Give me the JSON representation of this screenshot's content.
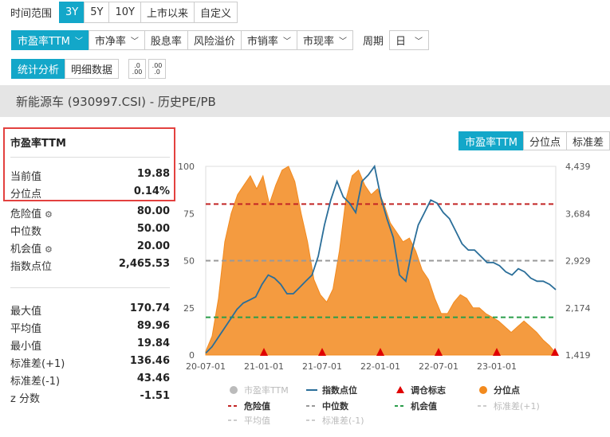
{
  "range": {
    "label": "时间范围",
    "options": [
      "3Y",
      "5Y",
      "10Y",
      "上市以来",
      "自定义"
    ],
    "active": "3Y"
  },
  "metrics": [
    "市盈率TTM",
    "市净率",
    "股息率",
    "风险溢价",
    "市销率",
    "市现率"
  ],
  "period": {
    "label": "周期",
    "value": "日"
  },
  "view_tabs": [
    "统计分析",
    "明细数据"
  ],
  "decimal_icons": [
    ".0 .00",
    ".00 .0"
  ],
  "page_title": "新能源车 (930997.CSI) - 历史PE/PB",
  "stats_title": "市盈率TTM",
  "stats": [
    {
      "label": "当前值",
      "value": "19.88"
    },
    {
      "label": "分位点",
      "value": "0.14%"
    },
    {
      "label": "危险值",
      "value": "80.00",
      "gear": true
    },
    {
      "label": "中位数",
      "value": "50.00"
    },
    {
      "label": "机会值",
      "value": "20.00",
      "gear": true
    },
    {
      "label": "指数点位",
      "value": "2,465.53"
    },
    {
      "label": "最大值",
      "value": "170.74"
    },
    {
      "label": "平均值",
      "value": "89.96"
    },
    {
      "label": "最小值",
      "value": "19.84"
    },
    {
      "label": "标准差(+1)",
      "value": "136.46"
    },
    {
      "label": "标准差(-1)",
      "value": "43.46"
    },
    {
      "label": "z 分数",
      "value": "-1.51"
    }
  ],
  "chart_tabs": [
    "市盈率TTM",
    "分位点",
    "标准差"
  ],
  "colors": {
    "accent": "#13a7c9",
    "area": "#f28a1e",
    "index": "#2a6e99",
    "danger": "#c22525",
    "median": "#999999",
    "opportunity": "#2a9d4a",
    "marker": "#e00000"
  },
  "chart_data": {
    "type": "area",
    "x_ticks": [
      "20-07-01",
      "21-01-01",
      "21-07-01",
      "22-01-01",
      "22-07-01",
      "23-01-01"
    ],
    "y_left_ticks": [
      "0",
      "25",
      "50",
      "75",
      "100"
    ],
    "y_right_ticks": [
      "1,419",
      "2,174",
      "2,929",
      "3,684",
      "4,439"
    ],
    "ylim_left": [
      0,
      100
    ],
    "ylim_right": [
      1419,
      4439
    ],
    "lines": {
      "danger": 80,
      "median": 50,
      "opportunity": 20
    },
    "percentile_series": [
      2,
      10,
      30,
      60,
      75,
      85,
      90,
      95,
      88,
      95,
      80,
      90,
      98,
      100,
      92,
      75,
      60,
      40,
      32,
      28,
      35,
      55,
      82,
      95,
      98,
      90,
      85,
      88,
      80,
      70,
      65,
      60,
      62,
      55,
      45,
      40,
      30,
      22,
      22,
      28,
      32,
      30,
      25,
      25,
      22,
      20,
      18,
      15,
      12,
      15,
      18,
      15,
      12,
      8,
      5,
      1
    ],
    "index_series": [
      1450,
      1550,
      1700,
      1850,
      2000,
      2150,
      2250,
      2300,
      2350,
      2550,
      2700,
      2650,
      2550,
      2400,
      2400,
      2500,
      2600,
      2700,
      3000,
      3500,
      3900,
      4200,
      3950,
      3850,
      3700,
      4200,
      4300,
      4439,
      3950,
      3600,
      3300,
      2700,
      2600,
      3100,
      3500,
      3700,
      3900,
      3850,
      3700,
      3600,
      3400,
      3200,
      3100,
      3100,
      3000,
      2900,
      2900,
      2850,
      2750,
      2700,
      2800,
      2750,
      2650,
      2600,
      2600,
      2550,
      2465
    ],
    "markers_x_index": [
      8,
      16,
      24,
      32,
      40,
      48
    ],
    "legend": [
      {
        "name": "市盈率TTM",
        "style": "dot-grey",
        "color": "#bbbbbb"
      },
      {
        "name": "指数点位",
        "style": "line",
        "color": "#2a6e99"
      },
      {
        "name": "调仓标志",
        "style": "triangle",
        "color": "#e00000"
      },
      {
        "name": "分位点",
        "style": "dot",
        "color": "#f28a1e"
      },
      {
        "name": "危险值",
        "style": "dash",
        "color": "#c22525"
      },
      {
        "name": "中位数",
        "style": "dash",
        "color": "#999999"
      },
      {
        "name": "机会值",
        "style": "dash",
        "color": "#2a9d4a"
      },
      {
        "name": "标准差(+1)",
        "style": "dash-light",
        "color": "#cccccc"
      },
      {
        "name": "平均值",
        "style": "dash-light",
        "color": "#cccccc"
      },
      {
        "name": "标准差(-1)",
        "style": "dash-light",
        "color": "#cccccc"
      }
    ]
  }
}
